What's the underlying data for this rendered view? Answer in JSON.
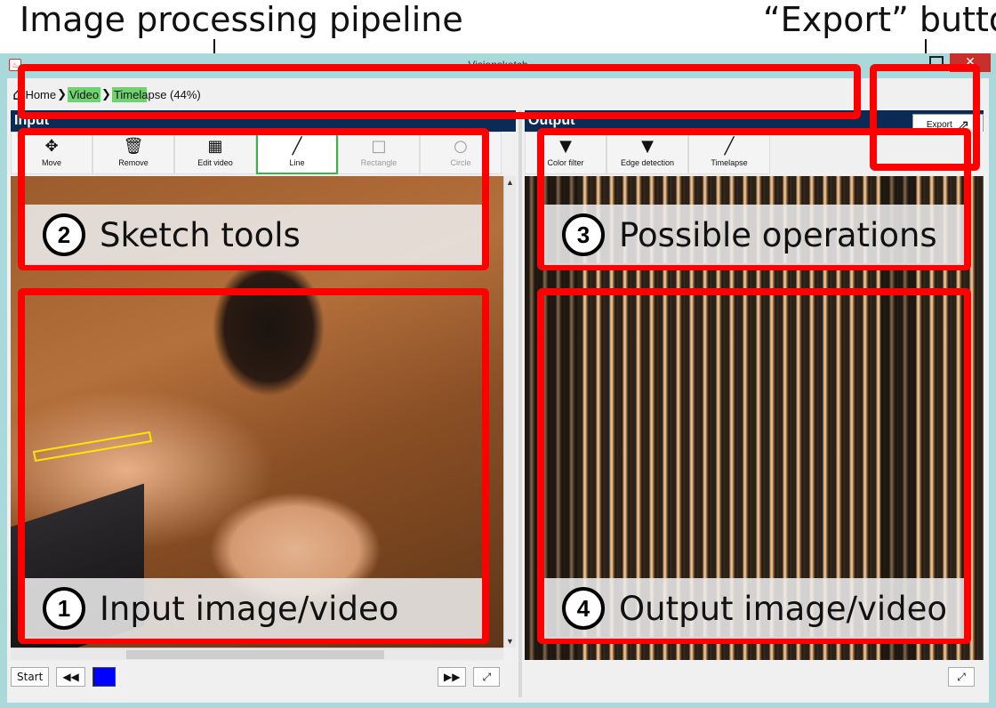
{
  "callouts": {
    "pipeline": "Image processing pipeline",
    "export": "“Export” button"
  },
  "window": {
    "title": "Visionsketch",
    "close_glyph": "✕"
  },
  "breadcrumb": {
    "items": [
      "Home",
      "Video",
      "Timelapse (44%)"
    ]
  },
  "panels": {
    "input_header": "Input",
    "output_header": "Output"
  },
  "export": {
    "label": "Export"
  },
  "sketch_tools": [
    {
      "label": "Move",
      "icon": "move-icon",
      "glyph": "✥",
      "state": "normal"
    },
    {
      "label": "Remove",
      "icon": "trash-icon",
      "glyph": "🗑",
      "state": "normal"
    },
    {
      "label": "Edit video",
      "icon": "film-icon",
      "glyph": "▦",
      "state": "normal"
    },
    {
      "label": "Line",
      "icon": "line-icon",
      "glyph": "╱",
      "state": "active"
    },
    {
      "label": "Rectangle",
      "icon": "rectangle-icon",
      "glyph": "□",
      "state": "disabled"
    },
    {
      "label": "Circle",
      "icon": "circle-icon",
      "glyph": "○",
      "state": "disabled"
    }
  ],
  "operations": [
    {
      "label": "Color filter",
      "icon": "filter-icon",
      "glyph": "▼"
    },
    {
      "label": "Edge detection",
      "icon": "filter-icon",
      "glyph": "▼"
    },
    {
      "label": "Timelapse",
      "icon": "line-icon",
      "glyph": "╱"
    }
  ],
  "controls": {
    "start": "Start",
    "rewind_glyph": "◀◀",
    "forward_glyph": "▶▶",
    "expand_glyph": "⤢",
    "swatch_color": "#0000ff"
  },
  "annotations": [
    {
      "num": "2",
      "label": "Sketch tools"
    },
    {
      "num": "3",
      "label": "Possible operations"
    },
    {
      "num": "1",
      "label": "Input image/video"
    },
    {
      "num": "4",
      "label": "Output image/video"
    }
  ],
  "colors": {
    "annotation_red": "#ff0000",
    "active_tool": "#3cb44b",
    "breadcrumb_highlight": "#6fd16f",
    "panel_header": "#0b2a55"
  }
}
